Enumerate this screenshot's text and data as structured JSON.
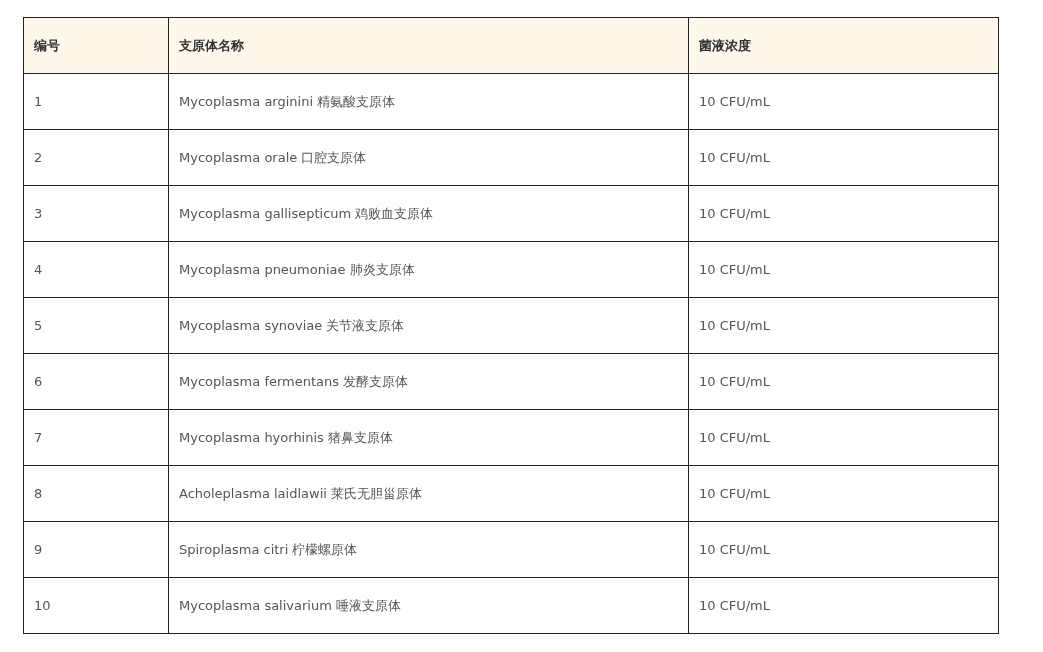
{
  "table": {
    "columns": [
      "编号",
      "支原体名称",
      "菌液浓度"
    ],
    "rows": [
      [
        "1",
        "Mycoplasma arginini 精氨酸支原体",
        "10 CFU/mL"
      ],
      [
        "2",
        "Mycoplasma orale 口腔支原体",
        "10 CFU/mL"
      ],
      [
        "3",
        "Mycoplasma gallisepticum 鸡败血支原体",
        "10 CFU/mL"
      ],
      [
        "4",
        "Mycoplasma pneumoniae 肺炎支原体",
        "10 CFU/mL"
      ],
      [
        "5",
        "Mycoplasma synoviae 关节液支原体",
        "10 CFU/mL"
      ],
      [
        "6",
        "Mycoplasma fermentans 发酵支原体",
        "10 CFU/mL"
      ],
      [
        "7",
        "Mycoplasma hyorhinis 猪鼻支原体",
        "10 CFU/mL"
      ],
      [
        "8",
        "Acholeplasma laidlawii 莱氏无胆甾原体",
        "10 CFU/mL"
      ],
      [
        "9",
        "Spiroplasma citri 柠檬螺原体",
        "10 CFU/mL"
      ],
      [
        "10",
        "Mycoplasma salivarium 唾液支原体",
        "10 CFU/mL"
      ]
    ]
  }
}
